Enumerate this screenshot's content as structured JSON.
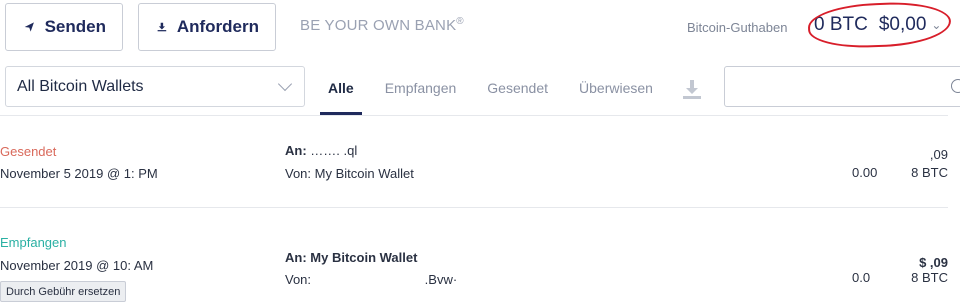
{
  "toolbar": {
    "send_label": "Senden",
    "request_label": "Anfordern",
    "tagline": "BE YOUR OWN BANK",
    "tagline_mark": "®"
  },
  "balance": {
    "label": "Bitcoin-Guthaben",
    "btc": "0 BTC",
    "fiat": "$0,00"
  },
  "filters": {
    "wallet_selected": "All Bitcoin Wallets",
    "tabs": [
      {
        "label": "Alle",
        "active": true
      },
      {
        "label": "Empfangen",
        "active": false
      },
      {
        "label": "Gesendet",
        "active": false
      },
      {
        "label": "Überwiesen",
        "active": false
      }
    ],
    "search_placeholder": ""
  },
  "transactions": [
    {
      "status": "Gesendet",
      "date": "November 5 2019 @ 1:      PM",
      "to_label": "An:",
      "to_value": "…….           .ql",
      "from_label": "Von:",
      "from_value": "My Bitcoin Wallet",
      "fiat_amount": ",09",
      "btc_prefix": "0.00",
      "btc_amount": "8 BTC"
    },
    {
      "status": "Empfangen",
      "date": "November     2019 @ 10:     AM",
      "to_label": "An:",
      "to_value": "My Bitcoin Wallet",
      "from_label": "Von:",
      "from_value": ".Bvw·",
      "fiat_amount": "$    ,09",
      "btc_prefix": "0.0",
      "btc_amount": "8 BTC",
      "action_label": "Durch Gebühr ersetzen"
    }
  ],
  "colors": {
    "primary": "#1f2a5c",
    "sent": "#d9695b",
    "received": "#2ab0a3",
    "annotation": "#d81e2a"
  }
}
